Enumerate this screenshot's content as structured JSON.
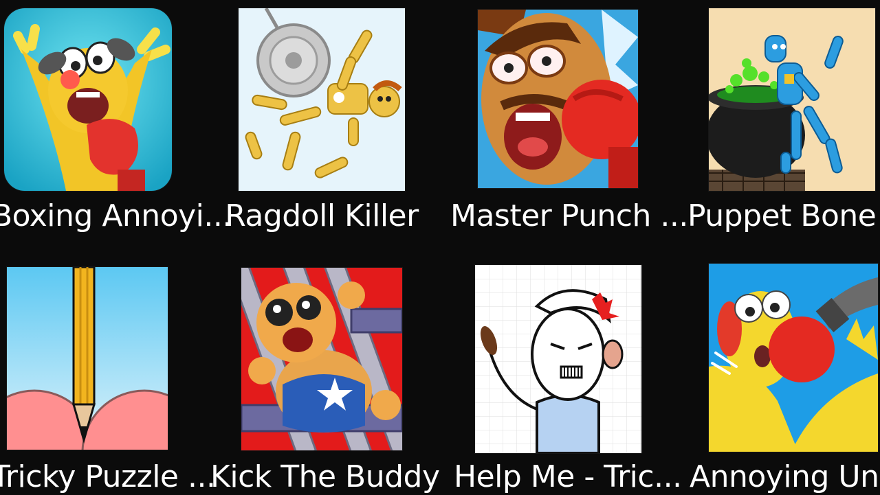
{
  "apps": [
    {
      "name": "Boxing Annoyi...",
      "icon": "boxing-annoying-icon"
    },
    {
      "name": "Ragdoll Killer",
      "icon": "ragdoll-killer-icon"
    },
    {
      "name": "Master Punch ...",
      "icon": "master-punch-icon"
    },
    {
      "name": "Puppet Bone ...",
      "icon": "puppet-bone-icon"
    },
    {
      "name": "Tricky Puzzle ...",
      "icon": "tricky-puzzle-icon"
    },
    {
      "name": "Kick The Buddy",
      "icon": "kick-the-buddy-icon"
    },
    {
      "name": "Help Me - Tric...",
      "icon": "help-me-tricky-icon"
    },
    {
      "name": "Annoying Uncl",
      "icon": "annoying-uncle-icon"
    }
  ]
}
